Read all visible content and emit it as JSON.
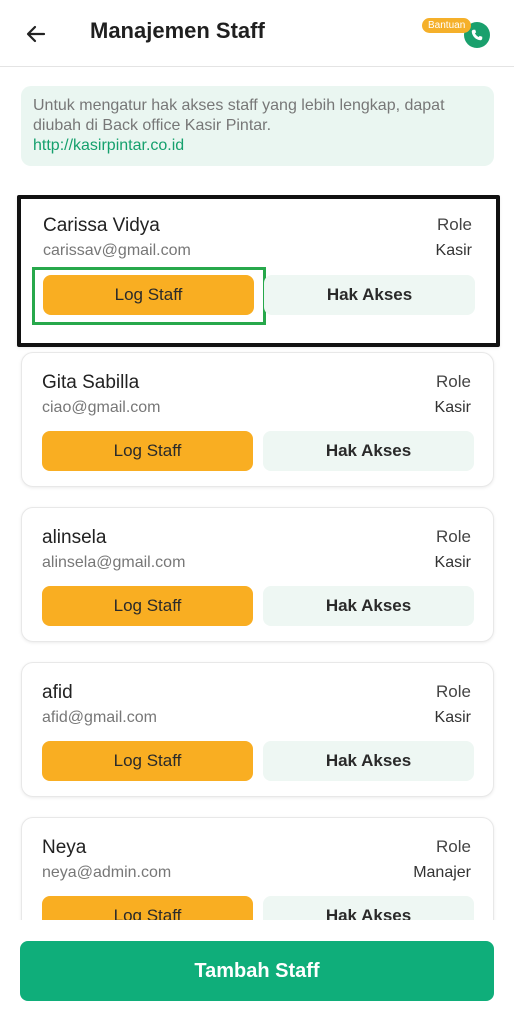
{
  "header": {
    "title": "Manajemen Staff",
    "help_label": "Bantuan",
    "back_icon": "arrow-left-icon",
    "help_icon": "whatsapp-phone-icon"
  },
  "info": {
    "text": "Untuk mengatur hak akses staff yang lebih lengkap, dapat diubah di Back office Kasir Pintar.",
    "link": "http://kasirpintar.co.id"
  },
  "staff": [
    {
      "name": "Carissa Vidya",
      "email": "carissav@gmail.com",
      "role_label": "Role",
      "role": "Kasir",
      "log_label": "Log Staff",
      "access_label": "Hak Akses"
    },
    {
      "name": "Gita Sabilla",
      "email": "ciao@gmail.com",
      "role_label": "Role",
      "role": "Kasir",
      "log_label": "Log Staff",
      "access_label": "Hak Akses"
    },
    {
      "name": "alinsela",
      "email": "alinsela@gmail.com",
      "role_label": "Role",
      "role": "Kasir",
      "log_label": "Log Staff",
      "access_label": "Hak Akses"
    },
    {
      "name": "afid",
      "email": "afid@gmail.com",
      "role_label": "Role",
      "role": "Kasir",
      "log_label": "Log Staff",
      "access_label": "Hak Akses"
    },
    {
      "name": "Neya",
      "email": "neya@admin.com",
      "role_label": "Role",
      "role": "Manajer",
      "log_label": "Log Staff",
      "access_label": "Hak Akses"
    }
  ],
  "footer": {
    "add_label": "Tambah Staff"
  },
  "colors": {
    "primary": "#0fae7a",
    "accent": "#f9ae22",
    "secondary_bg": "#eef7f3"
  }
}
